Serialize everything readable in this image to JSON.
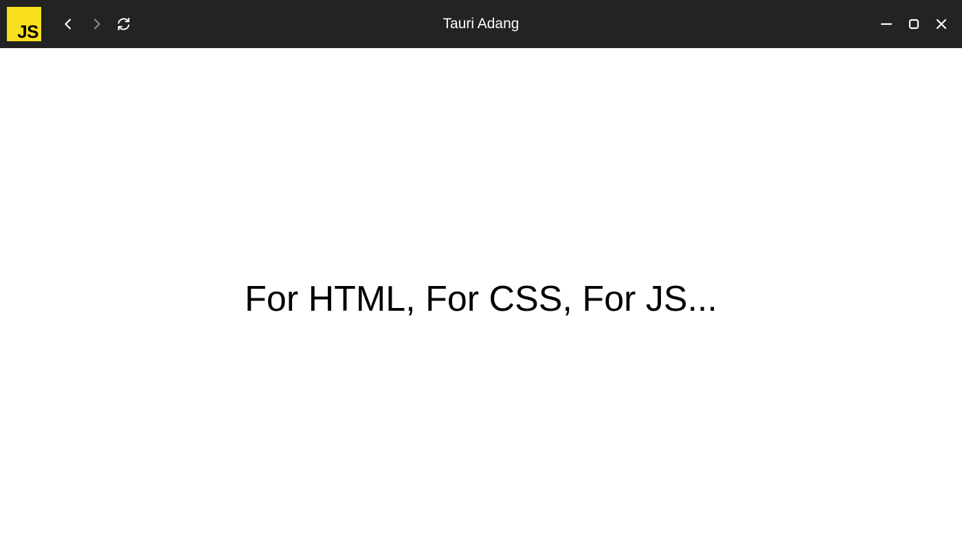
{
  "app": {
    "logo_text": "JS",
    "logo_color": "#f7df1e",
    "window_title": "Tauri Adang"
  },
  "titlebar": {
    "background": "#232323",
    "nav": [
      {
        "icon": "chevron-left-icon",
        "enabled": true
      },
      {
        "icon": "chevron-right-icon",
        "enabled": false
      },
      {
        "icon": "reload-icon",
        "enabled": true
      }
    ],
    "window_controls": [
      "minimize-icon",
      "maximize-icon",
      "close-icon"
    ]
  },
  "main": {
    "headline": "For HTML, For CSS, For JS..."
  }
}
